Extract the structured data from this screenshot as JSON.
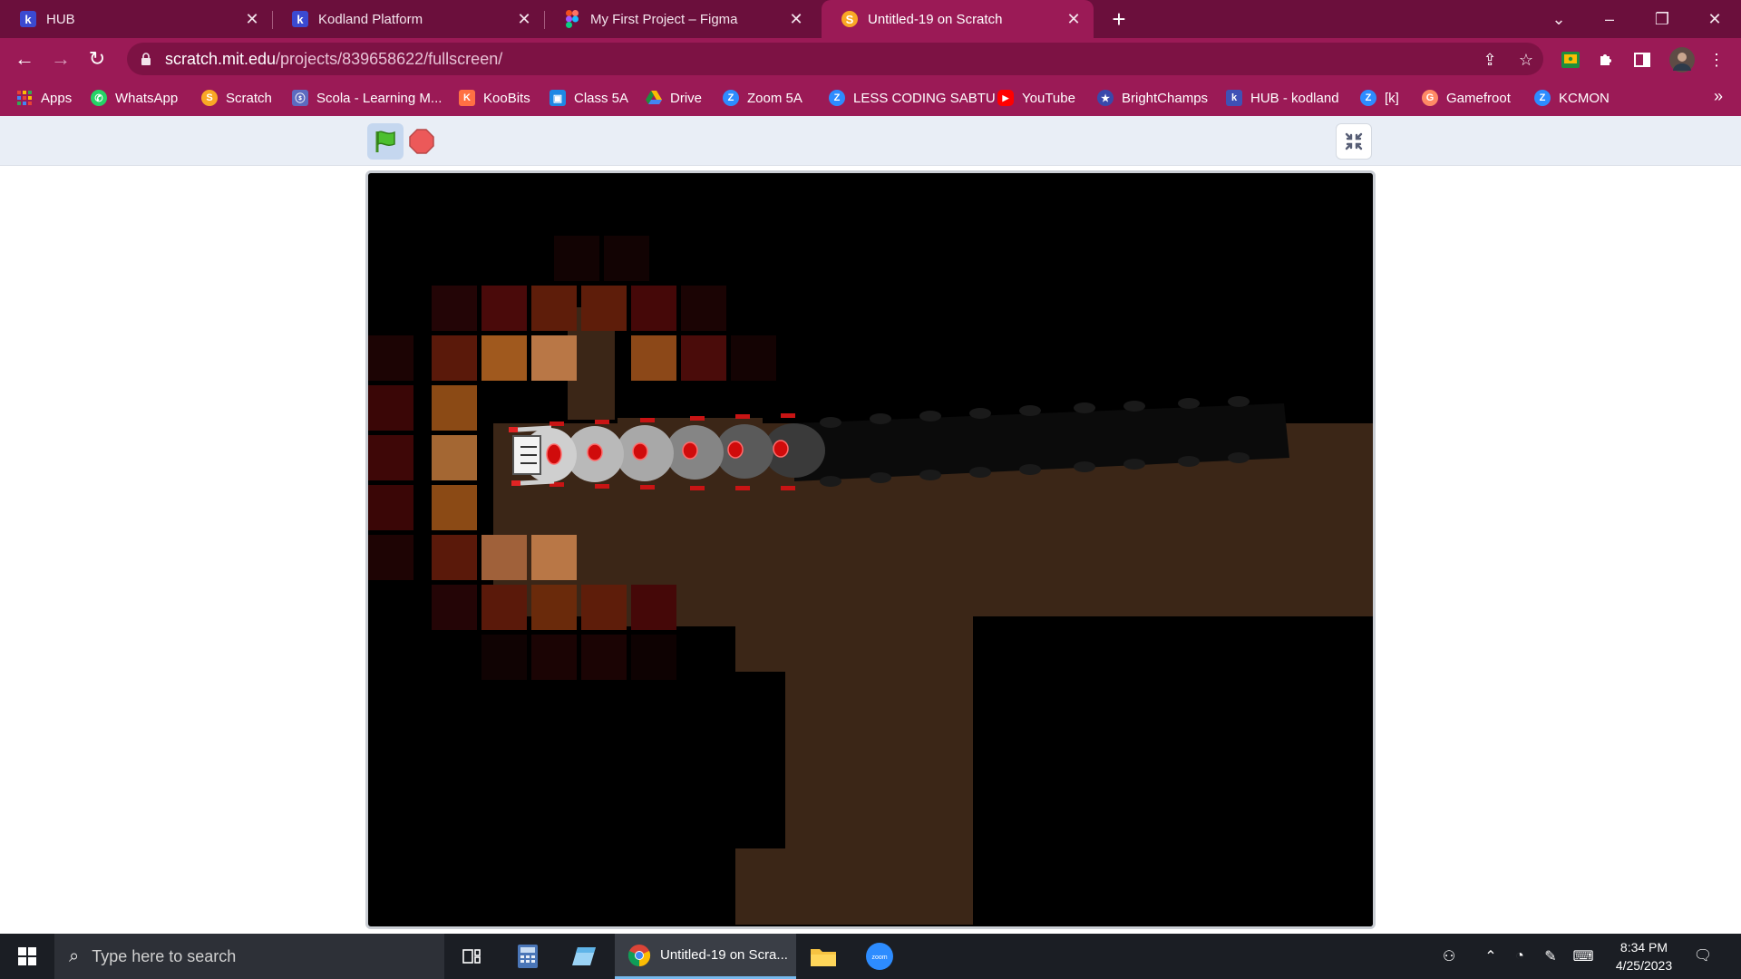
{
  "browser": {
    "tabs": [
      {
        "title": "HUB",
        "icon": "kodland-icon",
        "active": false
      },
      {
        "title": "Kodland Platform",
        "icon": "kodland-icon",
        "active": false
      },
      {
        "title": "My First Project – Figma",
        "icon": "figma-icon",
        "active": false
      },
      {
        "title": "Untitled-19 on Scratch",
        "icon": "scratch-icon",
        "active": true
      }
    ],
    "url_host": "scratch.mit.edu",
    "url_path": "/projects/839658622/fullscreen/",
    "bookmarks": [
      {
        "label": "Apps",
        "icon": "apps-grid-icon",
        "color": "#e94235"
      },
      {
        "label": "WhatsApp",
        "icon": "whatsapp-icon",
        "color": "#25d366"
      },
      {
        "label": "Scratch",
        "icon": "scratch-icon",
        "color": "#f9a825"
      },
      {
        "label": "Scola - Learning M...",
        "icon": "scola-icon",
        "color": "#5c6bc0"
      },
      {
        "label": "KooBits",
        "icon": "koobits-icon",
        "color": "#ff7043"
      },
      {
        "label": "Class 5A",
        "icon": "classroom-icon",
        "color": "#1e88e5"
      },
      {
        "label": "Drive",
        "icon": "drive-icon",
        "color": "#fbbc04"
      },
      {
        "label": "Zoom 5A",
        "icon": "zoom-icon",
        "color": "#2d8cff"
      },
      {
        "label": "LESS CODING SABTU",
        "icon": "zoom-icon",
        "color": "#2d8cff"
      },
      {
        "label": "YouTube",
        "icon": "youtube-icon",
        "color": "#ff0000"
      },
      {
        "label": "BrightChamps",
        "icon": "brightchamps-icon",
        "color": "#3949ab"
      },
      {
        "label": "HUB - kodland",
        "icon": "kodland-icon",
        "color": "#3f51b5"
      },
      {
        "label": "[k]",
        "icon": "zoom-icon",
        "color": "#2d8cff"
      },
      {
        "label": "Gamefroot",
        "icon": "gamefroot-icon",
        "color": "#ff8a65"
      },
      {
        "label": "KCMON",
        "icon": "zoom-icon",
        "color": "#2d8cff"
      }
    ],
    "bookmarks_overflow": "»"
  },
  "scratch": {
    "green_flag": "green-flag-icon",
    "stop": "stop-icon",
    "exit_fullscreen": "exit-fullscreen-icon"
  },
  "taskbar": {
    "search_placeholder": "Type here to search",
    "chrome_task_label": "Untitled-19 on Scra...",
    "time": "8:34 PM",
    "date": "4/25/2023"
  },
  "colors": {
    "tabstrip": "#6b0f3c",
    "toolbar": "#9b1a56",
    "stage_floor": "#3b2617"
  }
}
